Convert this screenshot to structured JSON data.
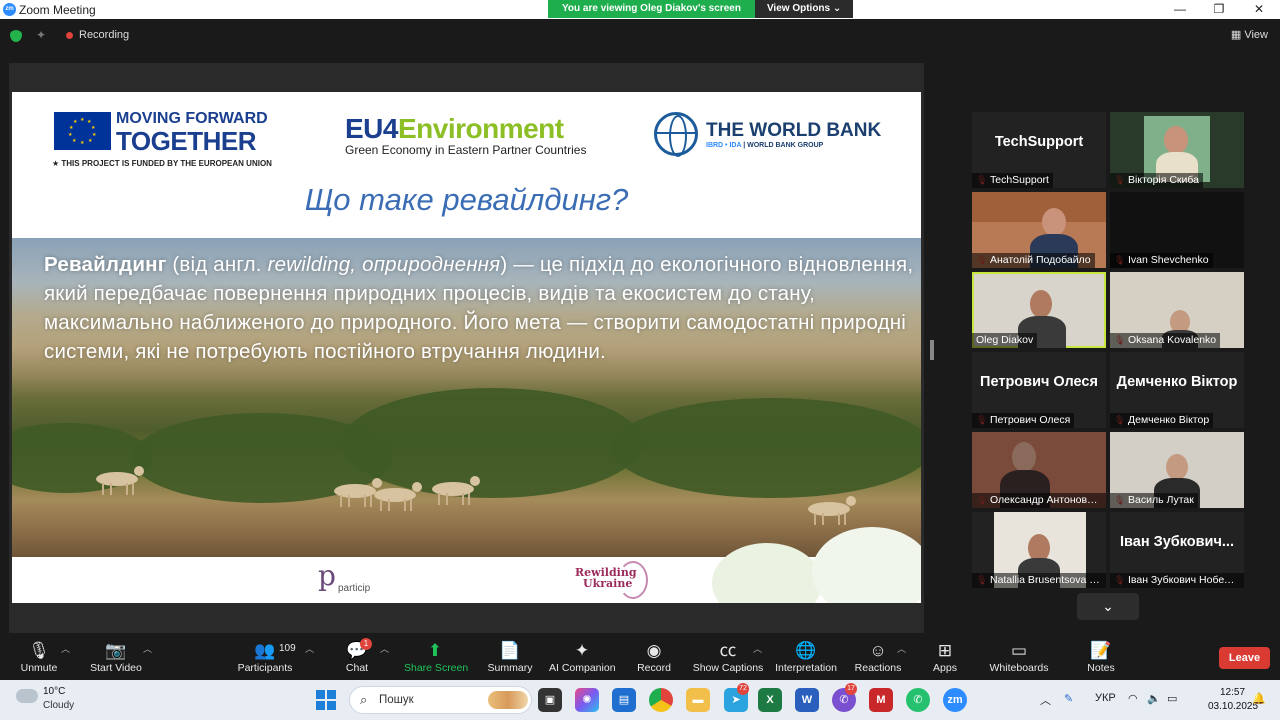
{
  "window": {
    "title": "Zoom Meeting",
    "viewing_banner": "You are viewing Oleg Diakov's screen",
    "view_options": "View Options",
    "minimize": "—",
    "maximize": "❐",
    "close": "✕"
  },
  "topbar": {
    "recording": "Recording",
    "view": "View"
  },
  "slide": {
    "logo_eu_line1": "MOVING FORWARD",
    "logo_eu_line2": "TOGETHER",
    "logo_eu_line3": "★ THIS PROJECT IS FUNDED BY THE EUROPEAN UNION",
    "logo_eu4env_eu4": "EU4",
    "logo_eu4env_env": "Environment",
    "logo_eu4env_sub": "Green Economy in Eastern Partner Countries",
    "logo_wb_main": "THE WORLD BANK",
    "logo_wb_sub_ibrd": "IBRD • IDA",
    "logo_wb_sub_rest": " | WORLD BANK GROUP",
    "title": "Що таке ревайлдинг?",
    "body_bold": "Ревайлдинг",
    "body_paren_open": " (від англ. ",
    "body_italic": "rewilding, оприроднення",
    "body_rest": ") — це підхід до екологічного відновлення, який передбачає повернення природних процесів, видів та екосистем до стану, максимально наближеного до природного. Його мета — створити самодостатні природні системи, які не потребують постійного втручання людини.",
    "footer_partcip_letter": "p",
    "footer_partcip": "particip",
    "footer_rewilding_1": "Rewilding",
    "footer_rewilding_2": "Ukraine"
  },
  "gallery": [
    {
      "name": "TechSupport",
      "big": "TechSupport",
      "video": false
    },
    {
      "name": "Вікторія Скиба",
      "big": "",
      "video": true
    },
    {
      "name": "Анатолій Подобайло",
      "big": "",
      "video": true
    },
    {
      "name": "Ivan Shevchenko",
      "big": "",
      "video": false
    },
    {
      "name": "Oleg Diakov",
      "big": "",
      "video": true
    },
    {
      "name": "Oksana Kovalenko",
      "big": "",
      "video": true
    },
    {
      "name": "Петрович Олеся",
      "big": "Петрович Олеся",
      "video": false
    },
    {
      "name": "Демченко Віктор",
      "big": "Демченко Віктор",
      "video": false
    },
    {
      "name": "Олександр Антоновсь...",
      "big": "",
      "video": true
    },
    {
      "name": "Василь Лутак",
      "big": "",
      "video": true
    },
    {
      "name": "Natallia Brusentsova N...",
      "big": "",
      "video": true
    },
    {
      "name": "Іван Зубкович Нобель...",
      "big": "Іван Зубкович...",
      "video": false
    }
  ],
  "toolbar": {
    "unmute": "Unmute",
    "start_video": "Start Video",
    "participants": "Participants",
    "participants_count": "109",
    "chat": "Chat",
    "chat_badge": "1",
    "share_screen": "Share Screen",
    "summary": "Summary",
    "ai_companion": "AI Companion",
    "record": "Record",
    "show_captions": "Show Captions",
    "interpretation": "Interpretation",
    "reactions": "Reactions",
    "apps": "Apps",
    "whiteboards": "Whiteboards",
    "notes": "Notes",
    "leave": "Leave"
  },
  "taskbar": {
    "temperature": "10°C",
    "condition": "Cloudy",
    "search_placeholder": "Пошук",
    "telegram_badge": "72",
    "viber_badge": "17",
    "language": "УКР",
    "time": "12:57",
    "date": "03.10.2025"
  },
  "colors": {
    "zoom_blue": "#2d8cff",
    "share_green": "#1fc35a",
    "leave_red": "#d93a32",
    "slide_title_blue": "#3b6db5",
    "eu4env_green": "#8cbf26"
  }
}
